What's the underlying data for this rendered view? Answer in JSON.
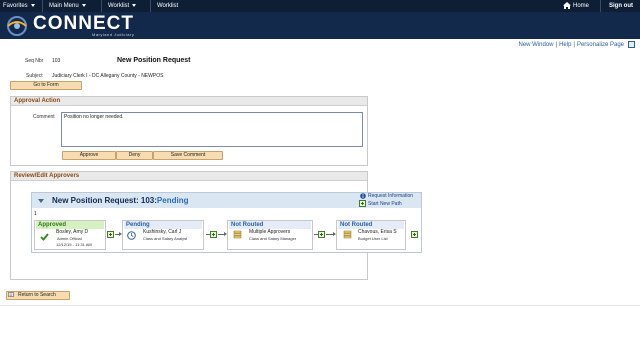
{
  "topnav": {
    "favorites": "Favorites",
    "main_menu": "Main Menu",
    "breadcrumb_1": "Worklist",
    "breadcrumb_2": "Worklist",
    "home": "Home",
    "sign_out": "Sign out"
  },
  "banner": {
    "logo_text": "CONNECT",
    "logo_sub": "Maryland Judiciary"
  },
  "utility": {
    "new_window": "New Window",
    "help": "Help",
    "personalize": "Personalize Page"
  },
  "request": {
    "seq_label": "Seq Nbr",
    "seq_value": "103",
    "title": "New Position Request",
    "subject_label": "Subject",
    "subject_value": "Judiciary Clerk I - DC Allegany County - NEWPOS",
    "go_to_form": "Go to Form"
  },
  "approval": {
    "header": "Approval Action",
    "comment_label": "Comment",
    "comment_value": "Position no longer needed.",
    "approve": "Approve",
    "deny": "Deny",
    "save_comment": "Save Comment"
  },
  "review": {
    "header": "Review/Edit Approvers",
    "flow_title_prefix": "New Position Request: 103:",
    "flow_status": "Pending",
    "request_information": "Request Information",
    "start_new_path": "Start New Path",
    "path_number": "1",
    "stages": [
      {
        "status": "Approved",
        "name": "Bosley, Amy D",
        "role": "Admin Official",
        "date": "12/12/15 - 11:31 AM"
      },
      {
        "status": "Pending",
        "name": "Kushinsky, Carl J",
        "role": "Class and Salary Analyst"
      },
      {
        "status": "Not Routed",
        "name": "Multiple Approvers",
        "role": "Class and Salary Manager"
      },
      {
        "status": "Not Routed",
        "name": "Chavous, Erisa S",
        "role": "Budget User List"
      }
    ]
  },
  "footer": {
    "return_to_search": "Return to Search"
  },
  "colors": {
    "nav_bg": "#0e1e35",
    "banner_bg": "#13294b",
    "button_bg": "#f6dcb0",
    "section_title": "#8a4a12",
    "approved_bg": "#d7f0c2",
    "pending_text": "#2a6ab8"
  },
  "icons": [
    "home-icon",
    "connect-logo-icon",
    "personalize-box-icon",
    "info-icon",
    "plus-icon",
    "checkmark-icon",
    "clock-icon",
    "approvers-stack-icon",
    "add-approver-icon",
    "return-search-icon"
  ]
}
